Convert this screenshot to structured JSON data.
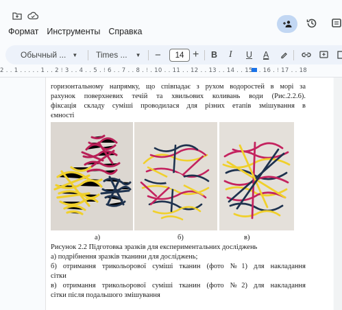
{
  "top_icons": {
    "folder": "move-to-folder-icon",
    "cloud": "cloud-saved-icon"
  },
  "menu": [
    "Формат",
    "Инструменты",
    "Справка"
  ],
  "toolbar": {
    "style_label": "Обычный ...",
    "font_label": "Times ...",
    "font_size": "14",
    "bold": "B",
    "italic": "I",
    "underline": "U",
    "text_color": "A"
  },
  "ruler": {
    "numbers": "2 . . 1 . . . . . 1 . . 2 ⁝ 3 . . 4 . . 5 . ⁝ 6 . . 7 . . 8 . ⁝ . 10 . . 11 . . 12 . . 13 . . 14 . . 15 . . 16 . ⁝ 17 . . 18"
  },
  "document": {
    "para1": [
      "горизонтальному напрямку, що співпадає з рухом водоростей в морі за",
      "рахунок поверхневих течій та  хвильових коливань води (Рис.2.2.6).",
      "фіксація складу суміші проводилася для різних етапів змішування в",
      "ємності"
    ],
    "photo_labels": [
      "а)",
      "б)",
      "в)"
    ],
    "figure_caption": "Рисунок 2.2 Підготовка зразків для експериментальних досліджень",
    "items": [
      "а) подрібнення зразків тканини для досліджень;",
      "б) отримання  трикольорової суміші  тканин (фото №1) для накладання",
      "сітки",
      "в) отримання  трикольорової суміші  тканин (фото №2) для накладання",
      "сітки після подальшого змішування"
    ]
  },
  "colors": {
    "accent": "#1a73e8",
    "yellow": "#f2d33a",
    "magenta": "#c4235f",
    "navy": "#1f3550"
  }
}
